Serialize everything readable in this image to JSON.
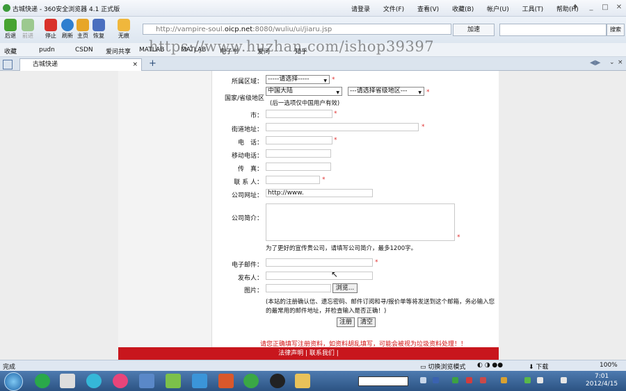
{
  "window": {
    "title": "古城快递 - 360安全浏览器 4.1 正式版",
    "menus": [
      "请登录",
      "文件(F)",
      "查看(V)",
      "收藏(B)",
      "帐户(U)",
      "工具(T)",
      "帮助(H)"
    ]
  },
  "toolbar": {
    "buttons": [
      "后退",
      "前进",
      "停止",
      "刷新",
      "主页",
      "恢复",
      "无痕"
    ],
    "address_prefix": "http://vampire-soul.",
    "address_domain": "oicp.net",
    "address_suffix": ":8080/wuliu/ui/jiaru.jsp",
    "speed_label": "加速",
    "search_button": "搜索"
  },
  "favorites": [
    "收藏",
    "pudn",
    "CSDN",
    "爱问共享",
    "MATLAB",
    "MATLAB",
    "电子书",
    "爱问",
    "知乎"
  ],
  "watermark": "https://www.huzhan.com/ishop39397",
  "tab": {
    "label": "古城快递"
  },
  "form": {
    "region_label": "所属区域：",
    "region_value": "-----请选择-----",
    "country_label": "国家/省级地区",
    "country_value": "中国大陆",
    "province_value": "---请选择省级地区---",
    "country_note": "(后一选项仅中国用户有效)",
    "city_label": "市：",
    "street_label": "街道地址：",
    "phone_label": "电　话：",
    "mobile_label": "移动电话：",
    "fax_label": "传　真：",
    "contact_label": "联 系 人：",
    "website_label": "公司网址：",
    "website_value": "http://www.",
    "intro_label": "公司简介：",
    "intro_note": "为了更好的宣传贵公司，请填写公司简介，最多1200字。",
    "email_label": "电子邮件：",
    "publisher_label": "发布人：",
    "image_label": "图片：",
    "browse_button": "浏览...",
    "email_note_1": "(本站的注册确认信、遗忘密码、邮件订阅和寻/报价单等将发送到这个邮箱，务必输入您",
    "email_note_2": "的最常用的邮件地址，并检查输入是否正确！)",
    "register_button": "注册",
    "clear_button": "清空",
    "warning": "请您正确填写注册资料，如资料胡乱填写，可能会被视为垃圾资料处理！！"
  },
  "footer": {
    "links": "法律声明 | 联系我们 |"
  },
  "status": {
    "text": "完成",
    "mode": "切换浏览模式",
    "download": "下载",
    "zoom": "100%"
  },
  "taskbar": {
    "time": "7:01",
    "date": "2012/4/15"
  }
}
